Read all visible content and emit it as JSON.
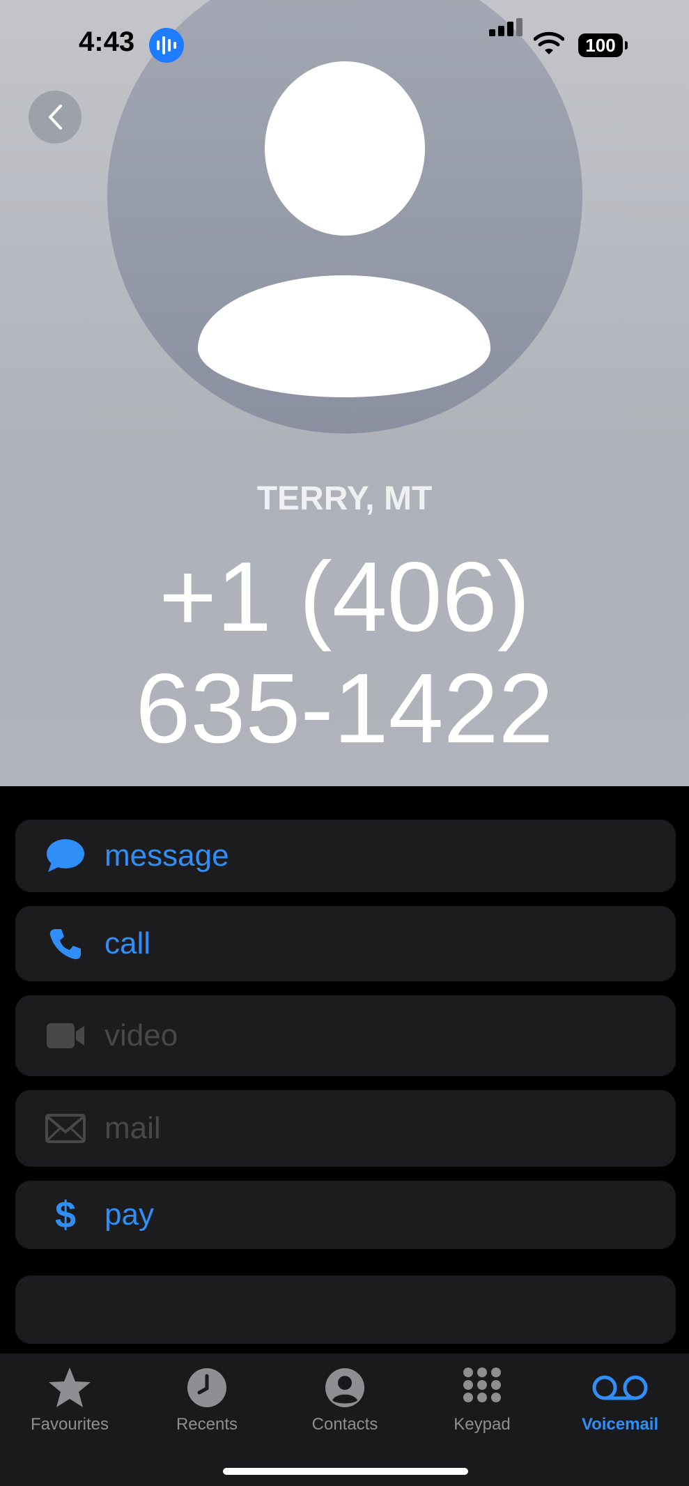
{
  "status_bar": {
    "time": "4:43",
    "battery": "100"
  },
  "contact": {
    "location": "TERRY, MT",
    "phone_line1": "+1 (406)",
    "phone_line2": "635-1422"
  },
  "actions": [
    {
      "label": "message",
      "icon": "message-bubble-icon",
      "enabled": true
    },
    {
      "label": "call",
      "icon": "phone-icon",
      "enabled": true
    },
    {
      "label": "video",
      "icon": "video-camera-icon",
      "enabled": false
    },
    {
      "label": "mail",
      "icon": "envelope-icon",
      "enabled": false
    },
    {
      "label": "pay",
      "icon": "dollar-icon",
      "enabled": true
    }
  ],
  "tabs": [
    {
      "label": "Favourites",
      "icon": "star-icon"
    },
    {
      "label": "Recents",
      "icon": "clock-icon"
    },
    {
      "label": "Contacts",
      "icon": "person-circle-icon"
    },
    {
      "label": "Keypad",
      "icon": "keypad-icon"
    },
    {
      "label": "Voicemail",
      "icon": "voicemail-icon",
      "active": true
    }
  ],
  "colors": {
    "accent": "#2f8ff6",
    "disabled": "#48484a",
    "row_bg": "#1c1c1e"
  }
}
